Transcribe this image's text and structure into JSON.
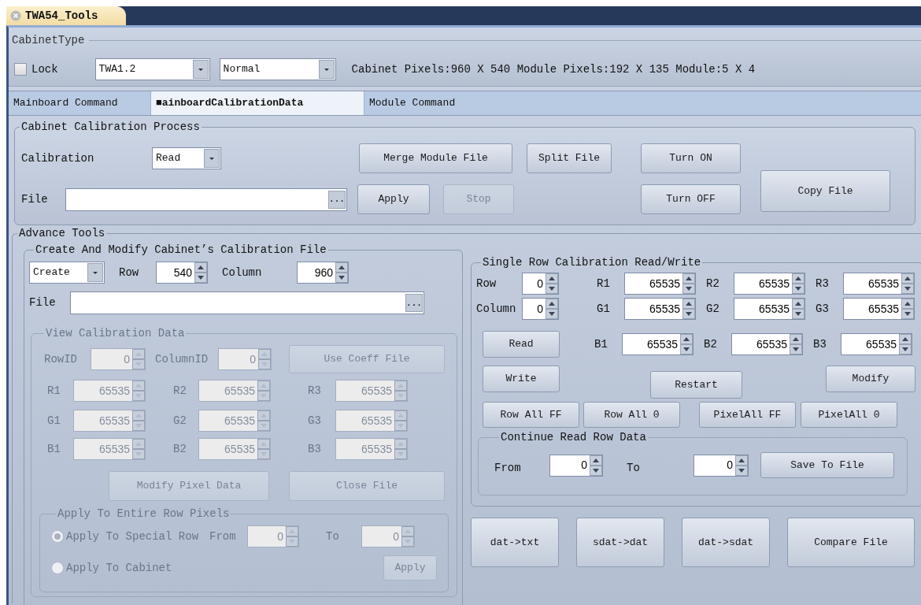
{
  "document_tab": {
    "title": "TWA54_Tools"
  },
  "cabinet_type": {
    "title": "CabinetType",
    "lock": {
      "label": "Lock",
      "checked": false
    },
    "model": "TWA1.2",
    "mode": "Normal",
    "info": "Cabinet Pixels:960 X 540 Module Pixels:192 X 135 Module:5 X 4"
  },
  "tabs": [
    {
      "label": "Mainboard Command",
      "selected": false
    },
    {
      "label": "■ainboardCalibrationData",
      "selected": true
    },
    {
      "label": "Module Command",
      "selected": false
    }
  ],
  "calibration_process": {
    "title": "Cabinet Calibration Process",
    "calibration_label": "Calibration",
    "calibration_mode": "Read",
    "file_label": "File",
    "file_browse": "...",
    "buttons": [
      {
        "label": "Merge Module File",
        "disabled": false
      },
      {
        "label": "Split File",
        "disabled": false
      },
      {
        "label": "Turn ON",
        "disabled": false
      },
      {
        "label": "Apply",
        "disabled": false
      },
      {
        "label": "Stop",
        "disabled": true
      },
      {
        "label": "Turn OFF",
        "disabled": false
      },
      {
        "label": "Copy File",
        "disabled": false
      }
    ]
  },
  "advance_tools": {
    "title": "Advance Tools",
    "create_modify": {
      "title": "Create And Modify Cabinet’s Calibration File",
      "action": "Create",
      "row_label": "Row",
      "row": "540",
      "column_label": "Column",
      "column": "960",
      "file_label": "File",
      "file_browse": "...",
      "view": {
        "title": "View Calibration Data",
        "disabled": true,
        "row_id_label": "RowID",
        "row_id": "0",
        "column_id_label": "ColumnID",
        "column_id": "0",
        "use_coeff_button": "Use Coeff File",
        "channels": [
          {
            "label": "R1",
            "value": "65535"
          },
          {
            "label": "R2",
            "value": "65535"
          },
          {
            "label": "R3",
            "value": "65535"
          },
          {
            "label": "G1",
            "value": "65535"
          },
          {
            "label": "G2",
            "value": "65535"
          },
          {
            "label": "G3",
            "value": "65535"
          },
          {
            "label": "B1",
            "value": "65535"
          },
          {
            "label": "B2",
            "value": "65535"
          },
          {
            "label": "B3",
            "value": "65535"
          }
        ],
        "modify_button": "Modify Pixel Data",
        "close_button": "Close File",
        "apply_group": {
          "title": "Apply To Entire Row Pixels",
          "options": [
            {
              "label": "Apply To Special Row",
              "selected": true
            },
            {
              "label": "Apply To Cabinet",
              "selected": false
            }
          ],
          "from_label": "From",
          "from": "0",
          "to_label": "To",
          "to": "0",
          "apply_button": "Apply"
        }
      }
    },
    "single_row": {
      "title": "Single Row Calibration Read/Write",
      "row_label": "Row",
      "row": "0",
      "column_label": "Column",
      "column": "0",
      "channels": [
        {
          "label": "R1",
          "value": "65535"
        },
        {
          "label": "R2",
          "value": "65535"
        },
        {
          "label": "R3",
          "value": "65535"
        },
        {
          "label": "G1",
          "value": "65535"
        },
        {
          "label": "G2",
          "value": "65535"
        },
        {
          "label": "G3",
          "value": "65535"
        },
        {
          "label": "B1",
          "value": "65535"
        },
        {
          "label": "B2",
          "value": "65535"
        },
        {
          "label": "B3",
          "value": "65535"
        }
      ],
      "read_button": "Read",
      "write_button": "Write",
      "restart_button": "Restart",
      "modify_button": "Modify",
      "fill_buttons": [
        "Row All FF",
        "Row All 0",
        "PixelAll FF",
        "PixelAll 0"
      ],
      "continue": {
        "title": "Continue Read Row Data",
        "from_label": "From",
        "from": "0",
        "to_label": "To",
        "to": "0",
        "save_button": "Save To File"
      }
    },
    "convert_buttons": [
      "dat->txt",
      "sdat->dat",
      "dat->sdat",
      "Compare File"
    ]
  }
}
